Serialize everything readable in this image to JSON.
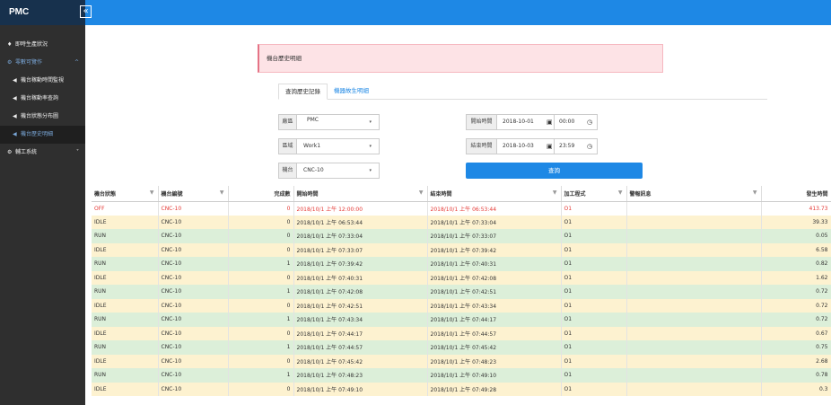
{
  "app": {
    "brand": "PMC",
    "collapse_icon": "«"
  },
  "sidebar": {
    "items": [
      {
        "icon": "home-icon",
        "glyph": "♦",
        "label": "即時生產狀況",
        "type": "top"
      },
      {
        "icon": "cog-icon",
        "glyph": "⚙",
        "label": "零數可覽作",
        "type": "parent",
        "chevron": "^"
      },
      {
        "icon": "speaker-icon",
        "glyph": "◀",
        "label": "機台稼動時間監視",
        "type": "sub"
      },
      {
        "icon": "speaker-icon",
        "glyph": "◀",
        "label": "機台稼動率查詢",
        "type": "sub"
      },
      {
        "icon": "speaker-icon",
        "glyph": "◀",
        "label": "機台狀態分布圖",
        "type": "sub"
      },
      {
        "icon": "speaker-icon",
        "glyph": "◀",
        "label": "機台歷史明細",
        "type": "selected"
      },
      {
        "icon": "cog-icon",
        "glyph": "⚙",
        "label": "輔工系統",
        "type": "top",
        "chevron": "˅"
      }
    ]
  },
  "alert": {
    "text": "機台歷史明細"
  },
  "tabs": {
    "active": "查詢歷史記錄",
    "other": "機器故生明細"
  },
  "filters": {
    "factory": {
      "label": "廠區",
      "value": "PMC"
    },
    "line": {
      "label": "區域",
      "value": "Work1"
    },
    "machine": {
      "label": "機台",
      "value": "CNC-10"
    },
    "start": {
      "label": "開始時間",
      "date": "2018-10-01",
      "time": "00:00"
    },
    "end": {
      "label": "結束時間",
      "date": "2018-10-03",
      "time": "23:59"
    },
    "query_label": "查詢",
    "caret": "▾",
    "calendar_glyph": "▣",
    "clock_glyph": "◷"
  },
  "table": {
    "filter_glyph": "▼",
    "columns": [
      "機台狀態",
      "機台編號",
      "完成數",
      "開始時間",
      "結束時間",
      "加工程式",
      "警報訊息",
      "發生時間"
    ],
    "rows": [
      {
        "status": "OFF",
        "machine": "CNC-10",
        "done": "0",
        "start": "2018/10/1 上午 12:00:00",
        "end": "2018/10/1 上午 06:53:44",
        "prog": "O1",
        "alarm": "",
        "duration": "413.73"
      },
      {
        "status": "IDLE",
        "machine": "CNC-10",
        "done": "0",
        "start": "2018/10/1 上午 06:53:44",
        "end": "2018/10/1 上午 07:33:04",
        "prog": "O1",
        "alarm": "",
        "duration": "39.33"
      },
      {
        "status": "RUN",
        "machine": "CNC-10",
        "done": "0",
        "start": "2018/10/1 上午 07:33:04",
        "end": "2018/10/1 上午 07:33:07",
        "prog": "O1",
        "alarm": "",
        "duration": "0.05"
      },
      {
        "status": "IDLE",
        "machine": "CNC-10",
        "done": "0",
        "start": "2018/10/1 上午 07:33:07",
        "end": "2018/10/1 上午 07:39:42",
        "prog": "O1",
        "alarm": "",
        "duration": "6.58"
      },
      {
        "status": "RUN",
        "machine": "CNC-10",
        "done": "1",
        "start": "2018/10/1 上午 07:39:42",
        "end": "2018/10/1 上午 07:40:31",
        "prog": "O1",
        "alarm": "",
        "duration": "0.82"
      },
      {
        "status": "IDLE",
        "machine": "CNC-10",
        "done": "0",
        "start": "2018/10/1 上午 07:40:31",
        "end": "2018/10/1 上午 07:42:08",
        "prog": "O1",
        "alarm": "",
        "duration": "1.62"
      },
      {
        "status": "RUN",
        "machine": "CNC-10",
        "done": "1",
        "start": "2018/10/1 上午 07:42:08",
        "end": "2018/10/1 上午 07:42:51",
        "prog": "O1",
        "alarm": "",
        "duration": "0.72"
      },
      {
        "status": "IDLE",
        "machine": "CNC-10",
        "done": "0",
        "start": "2018/10/1 上午 07:42:51",
        "end": "2018/10/1 上午 07:43:34",
        "prog": "O1",
        "alarm": "",
        "duration": "0.72"
      },
      {
        "status": "RUN",
        "machine": "CNC-10",
        "done": "1",
        "start": "2018/10/1 上午 07:43:34",
        "end": "2018/10/1 上午 07:44:17",
        "prog": "O1",
        "alarm": "",
        "duration": "0.72"
      },
      {
        "status": "IDLE",
        "machine": "CNC-10",
        "done": "0",
        "start": "2018/10/1 上午 07:44:17",
        "end": "2018/10/1 上午 07:44:57",
        "prog": "O1",
        "alarm": "",
        "duration": "0.67"
      },
      {
        "status": "RUN",
        "machine": "CNC-10",
        "done": "1",
        "start": "2018/10/1 上午 07:44:57",
        "end": "2018/10/1 上午 07:45:42",
        "prog": "O1",
        "alarm": "",
        "duration": "0.75"
      },
      {
        "status": "IDLE",
        "machine": "CNC-10",
        "done": "0",
        "start": "2018/10/1 上午 07:45:42",
        "end": "2018/10/1 上午 07:48:23",
        "prog": "O1",
        "alarm": "",
        "duration": "2.68"
      },
      {
        "status": "RUN",
        "machine": "CNC-10",
        "done": "1",
        "start": "2018/10/1 上午 07:48:23",
        "end": "2018/10/1 上午 07:49:10",
        "prog": "O1",
        "alarm": "",
        "duration": "0.78"
      },
      {
        "status": "IDLE",
        "machine": "CNC-10",
        "done": "0",
        "start": "2018/10/1 上午 07:49:10",
        "end": "2018/10/1 上午 07:49:28",
        "prog": "O1",
        "alarm": "",
        "duration": "0.3"
      }
    ]
  },
  "colors": {
    "topbar": "#1e88e5",
    "brand_bg": "#17314d",
    "sidebar_bg": "#2f2f2f",
    "idle_row": "#fdf2d0",
    "run_row": "#dcefd9",
    "off_text": "#e53935"
  }
}
